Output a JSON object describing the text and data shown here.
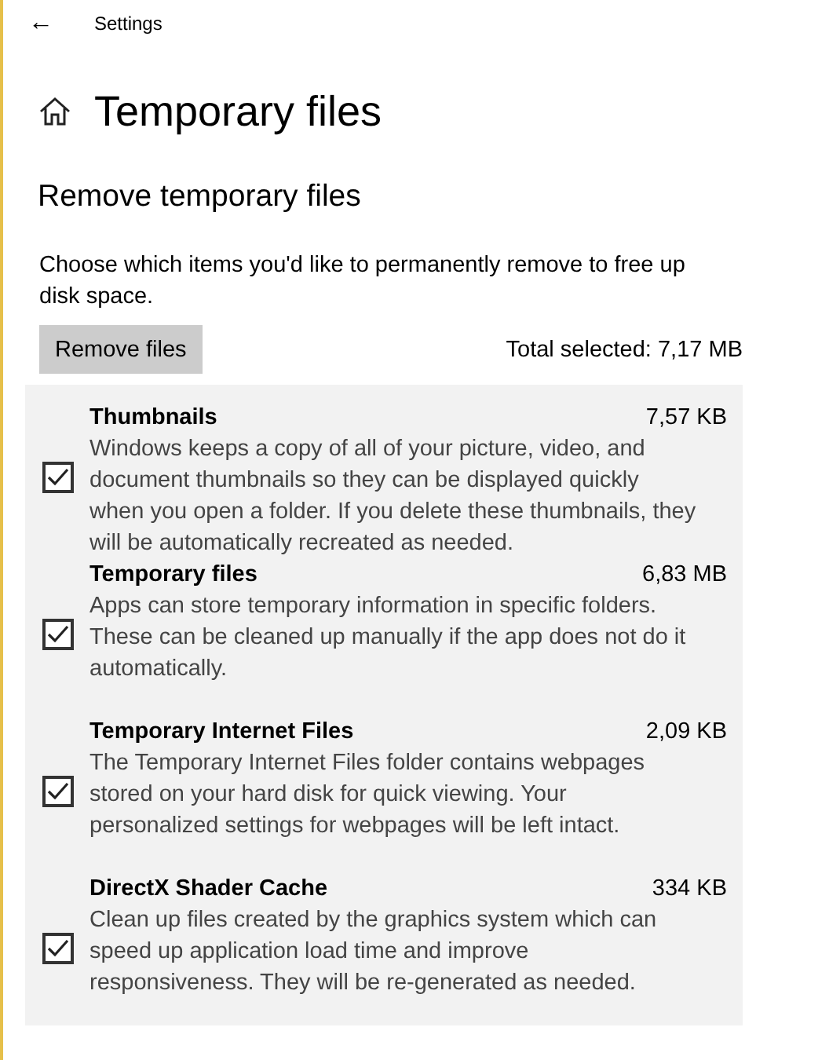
{
  "window": {
    "title": "Settings",
    "back_icon": "←"
  },
  "page": {
    "title": "Temporary files"
  },
  "section": {
    "title": "Remove temporary files",
    "description": "Choose which items you'd like to permanently remove to free up disk space.",
    "button": "Remove files",
    "total": "Total selected: 7,17 MB"
  },
  "items": [
    {
      "name": "Thumbnails",
      "size": "7,57 KB",
      "checked": true,
      "description": "Windows keeps a copy of all of your picture, video, and document thumbnails so they can be displayed quickly when you open a folder. If you delete these thumbnails, they will be automatically recreated as needed."
    },
    {
      "name": "Temporary files",
      "size": "6,83 MB",
      "checked": true,
      "description": "Apps can store temporary information in specific folders. These can be cleaned up manually if the app does not do it automatically."
    },
    {
      "name": "Temporary Internet Files",
      "size": "2,09 KB",
      "checked": true,
      "description": "The Temporary Internet Files folder contains webpages stored on your hard disk for quick viewing. Your personalized settings for webpages will be left intact."
    },
    {
      "name": "DirectX Shader Cache",
      "size": "334 KB",
      "checked": true,
      "description": "Clean up files created by the graphics system which can speed up application load time and improve responsiveness. They will be re-generated as needed."
    }
  ]
}
